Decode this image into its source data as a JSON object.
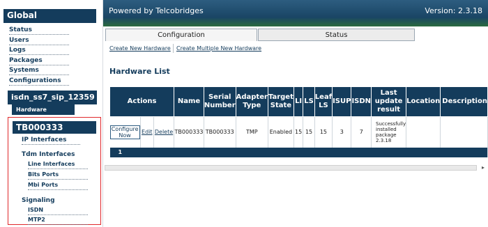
{
  "sidebar": {
    "global_title": "Global",
    "global_items": [
      "Status",
      "Users",
      "Logs",
      "Packages",
      "Systems",
      "Configurations"
    ],
    "system_title": "isdn_ss7_sip_12359",
    "hardware_link": "Hardware",
    "tb_title": "TB000333",
    "ip_interfaces": "IP Interfaces",
    "tdm_interfaces": "Tdm Interfaces",
    "tdm_sub": [
      "Line Interfaces",
      "Bits Ports",
      "Mbi Ports"
    ],
    "signaling": "Signaling",
    "signaling_sub": [
      "ISDN",
      "MTP2"
    ]
  },
  "banner": {
    "brand": "Powered by Telcobridges",
    "version": "Version: 2.3.18"
  },
  "tabs": {
    "configuration": "Configuration",
    "status": "Status"
  },
  "actions": {
    "create_new": "Create New Hardware",
    "create_multiple": "Create Multiple New Hardware"
  },
  "hardware_list": {
    "title": "Hardware List",
    "headers": {
      "actions": "Actions",
      "name": "Name",
      "serial": "Serial Number",
      "adapter": "Adapter Type",
      "target": "Target State",
      "li": "LI",
      "ls": "LS",
      "leafls": "Leaf LS",
      "isup": "ISUP",
      "isdn": "ISDN",
      "last": "Last update result",
      "location": "Location",
      "description": "Description"
    },
    "rows": [
      {
        "configure": "Configure Now",
        "edit": "Edit",
        "delete": "Delete",
        "name": "TB000333",
        "serial": "TB000333",
        "adapter": "TMP",
        "target": "Enabled",
        "li": "15",
        "ls": "15",
        "leafls": "15",
        "isup": "3",
        "isdn": "7",
        "last": "Successfully installed package 2.3.18",
        "location": "",
        "description": ""
      }
    ],
    "pager": "1"
  },
  "colors": {
    "navy": "#143c5c",
    "highlight_box": "#e0282b"
  }
}
